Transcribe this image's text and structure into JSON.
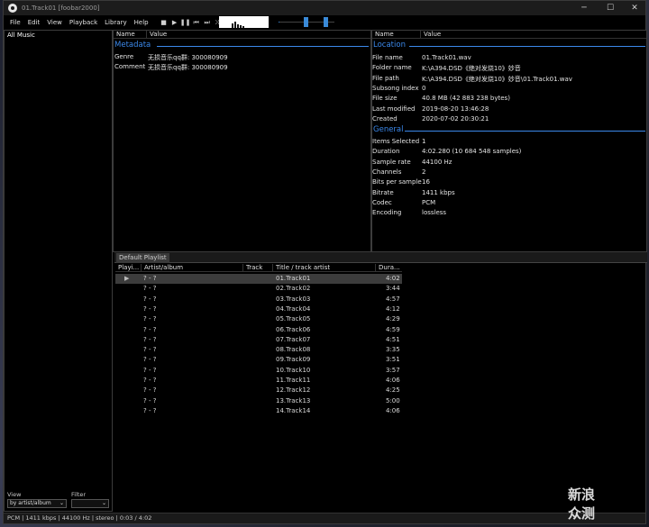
{
  "window": {
    "title": "01.Track01  [foobar2000]",
    "minimize_icon": "minimize-icon",
    "maximize_icon": "maximize-icon",
    "close_icon": "close-icon"
  },
  "menu": [
    "File",
    "Edit",
    "View",
    "Playback",
    "Library",
    "Help"
  ],
  "toolbar": [
    "stop-icon",
    "play-icon",
    "pause-icon",
    "previous-icon",
    "next-icon",
    "random-icon"
  ],
  "library": {
    "root_label": "All Music",
    "view_label": "View",
    "view_value": "by artist/album",
    "filter_label": "Filter",
    "filter_value": ""
  },
  "metadata_panel": {
    "headers": {
      "name": "Name",
      "value": "Value"
    },
    "section_title": "Metadata",
    "rows": [
      {
        "name": "Genre",
        "value": "无损音乐qq群: 300080909"
      },
      {
        "name": "Comment",
        "value": "无损音乐qq群: 300080909"
      }
    ]
  },
  "properties_panel": {
    "headers": {
      "name": "Name",
      "value": "Value"
    },
    "location_title": "Location",
    "location": [
      {
        "name": "File name",
        "value": "01.Track01.wav"
      },
      {
        "name": "Folder name",
        "value": "K:\\A394.DSD《绝对发烧10》妙音"
      },
      {
        "name": "File path",
        "value": "K:\\A394.DSD《绝对发烧10》妙音\\01.Track01.wav"
      },
      {
        "name": "Subsong index",
        "value": "0"
      },
      {
        "name": "File size",
        "value": "40.8 MB (42 883 238 bytes)"
      },
      {
        "name": "Last modified",
        "value": "2019-08-20 13:46:28"
      },
      {
        "name": "Created",
        "value": "2020-07-02 20:30:21"
      }
    ],
    "general_title": "General",
    "general": [
      {
        "name": "Items Selected",
        "value": "1"
      },
      {
        "name": "Duration",
        "value": "4:02.280 (10 684 548 samples)"
      },
      {
        "name": "Sample rate",
        "value": "44100 Hz"
      },
      {
        "name": "Channels",
        "value": "2"
      },
      {
        "name": "Bits per sample",
        "value": "16"
      },
      {
        "name": "Bitrate",
        "value": "1411 kbps"
      },
      {
        "name": "Codec",
        "value": "PCM"
      },
      {
        "name": "Encoding",
        "value": "lossless"
      }
    ]
  },
  "playlist": {
    "tab_label": "Default Playlist",
    "headers": {
      "playing": "Playi...",
      "artist_album": "Artist/album",
      "track_no": "Track no",
      "title": "Title / track artist",
      "duration": "Dura..."
    },
    "rows": [
      {
        "artist_album": "? - ?",
        "title": "01.Track01",
        "duration": "4:02",
        "playing": true
      },
      {
        "artist_album": "? - ?",
        "title": "02.Track02",
        "duration": "3:44"
      },
      {
        "artist_album": "? - ?",
        "title": "03.Track03",
        "duration": "4:57"
      },
      {
        "artist_album": "? - ?",
        "title": "04.Track04",
        "duration": "4:12"
      },
      {
        "artist_album": "? - ?",
        "title": "05.Track05",
        "duration": "4:29"
      },
      {
        "artist_album": "? - ?",
        "title": "06.Track06",
        "duration": "4:59"
      },
      {
        "artist_album": "? - ?",
        "title": "07.Track07",
        "duration": "4:51"
      },
      {
        "artist_album": "? - ?",
        "title": "08.Track08",
        "duration": "3:35"
      },
      {
        "artist_album": "? - ?",
        "title": "09.Track09",
        "duration": "3:51"
      },
      {
        "artist_album": "? - ?",
        "title": "10.Track10",
        "duration": "3:57"
      },
      {
        "artist_album": "? - ?",
        "title": "11.Track11",
        "duration": "4:06"
      },
      {
        "artist_album": "? - ?",
        "title": "12.Track12",
        "duration": "4:25"
      },
      {
        "artist_album": "? - ?",
        "title": "13.Track13",
        "duration": "5:00"
      },
      {
        "artist_album": "? - ?",
        "title": "14.Track14",
        "duration": "4:06"
      }
    ]
  },
  "status_bar": "PCM | 1411 kbps | 44100 Hz | stereo | 0:03 / 4:02",
  "seek_progress": 0.012,
  "watermark": "新浪众测",
  "colors": {
    "accent": "#3b88ea",
    "selected_row": "#3c3c3c"
  }
}
